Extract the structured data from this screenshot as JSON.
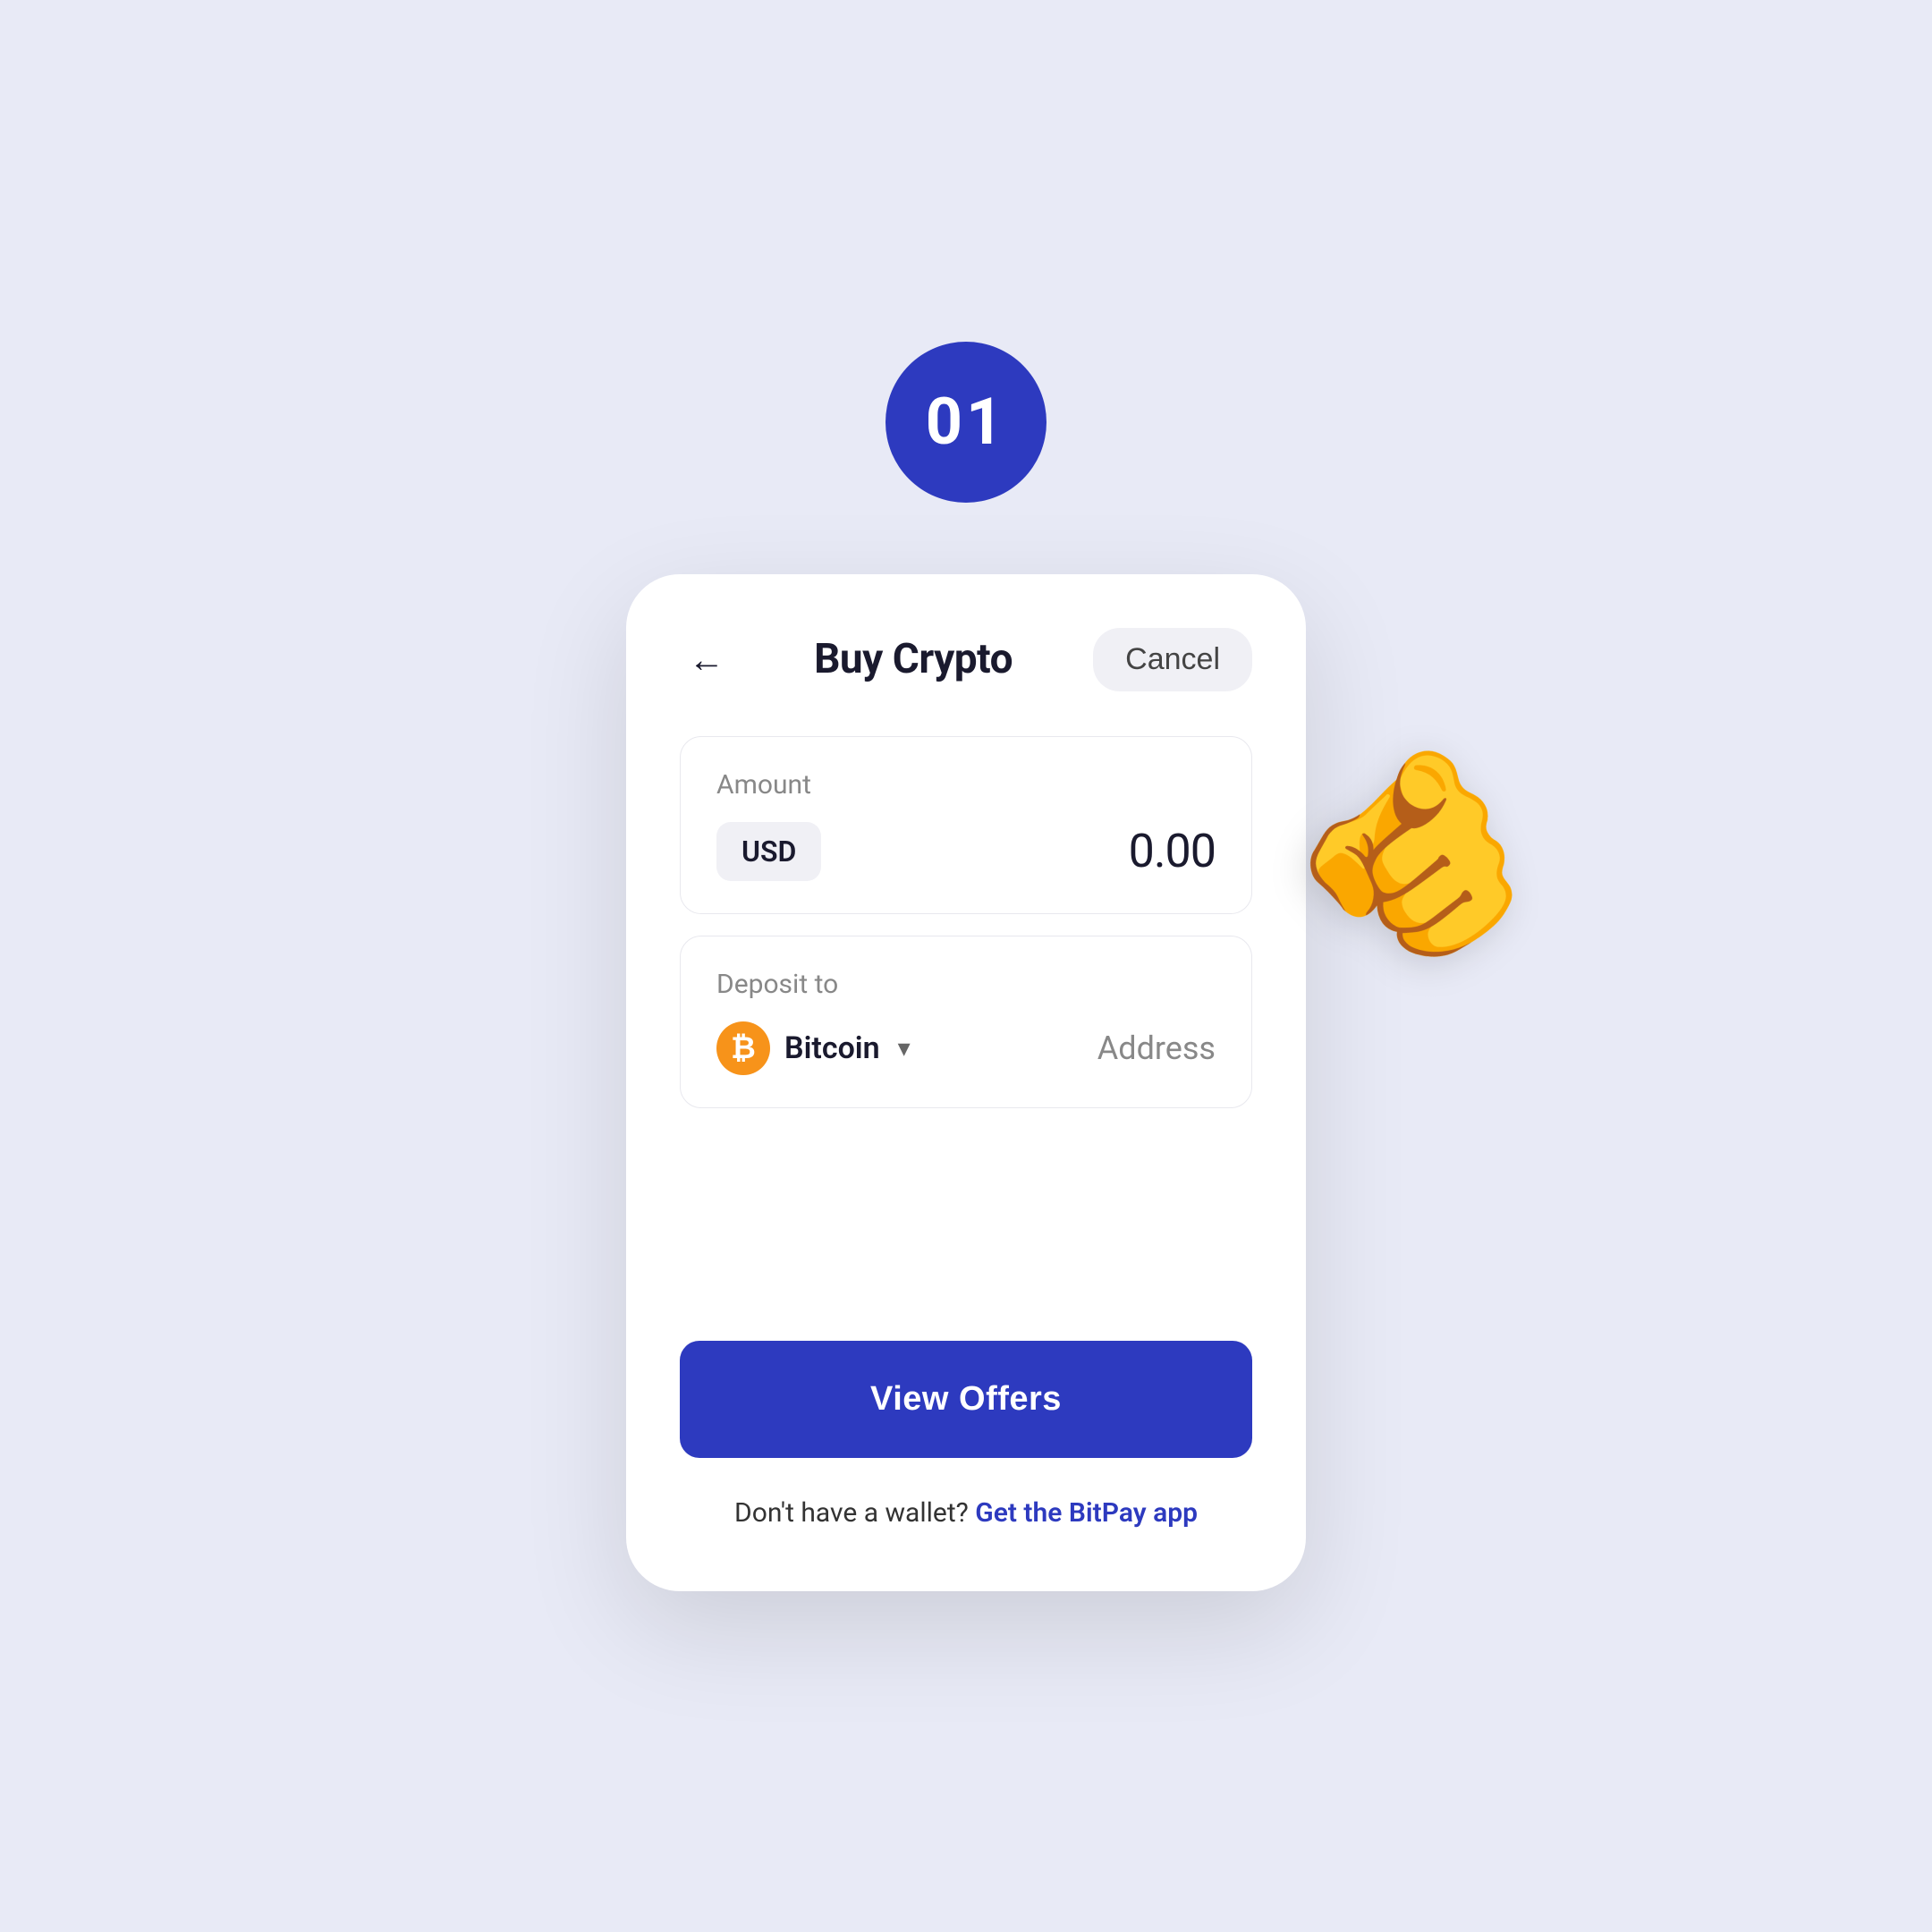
{
  "page": {
    "background_color": "#e8eaf6"
  },
  "step_badge": {
    "number": "01",
    "background": "#2d3abf",
    "text_color": "#ffffff"
  },
  "header": {
    "title": "Buy Crypto",
    "back_label": "←",
    "cancel_label": "Cancel"
  },
  "amount_section": {
    "label": "Amount",
    "currency": "USD",
    "value": "0.00"
  },
  "deposit_section": {
    "label": "Deposit to",
    "crypto_name": "Bitcoin",
    "address_placeholder": "Address"
  },
  "view_offers_button": {
    "label": "View Offers"
  },
  "footer": {
    "text": "Don't have a wallet?",
    "link_text": "Get the BitPay app"
  }
}
